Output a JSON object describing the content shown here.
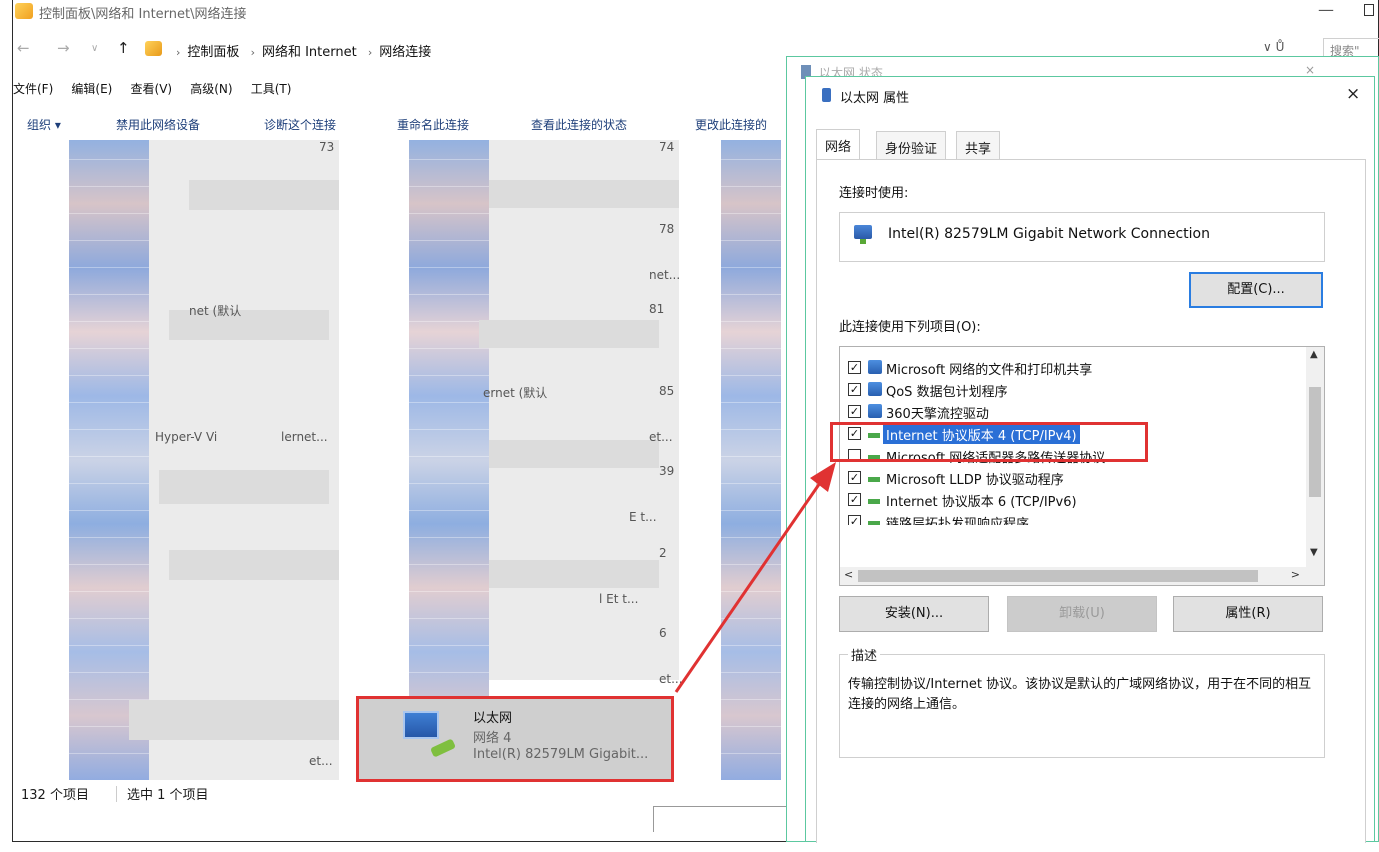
{
  "explorer": {
    "title": "控制面板\\网络和 Internet\\网络连接",
    "minimize": "—",
    "breadcrumbs": [
      "控制面板",
      "网络和 Internet",
      "网络连接"
    ],
    "search_placeholder": "搜索\"",
    "addr_controls": "∨ Ů",
    "menu": [
      "文件(F)",
      "编辑(E)",
      "查看(V)",
      "高级(N)",
      "工具(T)"
    ],
    "commands": [
      "组织 ▾",
      "禁用此网络设备",
      "诊断这个连接",
      "重命名此连接",
      "查看此连接的状态",
      "更改此连接的"
    ],
    "blurred_fragments": [
      "73",
      "74",
      "78",
      "net...",
      "81",
      "85",
      "Hyper-V Vi",
      "lernet...",
      "et...",
      "39",
      "E t...",
      "2",
      "l Et t...",
      "6",
      "et...",
      "et...",
      "net (默认",
      "ernet (默认"
    ],
    "selected_item": {
      "name": "以太网",
      "network": "网络 4",
      "adapter": "Intel(R) 82579LM Gigabit..."
    },
    "status": {
      "count": "132 个项目",
      "selected": "选中 1 个项目"
    }
  },
  "status_dialog": {
    "title": "以太网 状态",
    "close": "×"
  },
  "properties": {
    "title": "以太网 属性",
    "close": "×",
    "tabs": [
      "网络",
      "身份验证",
      "共享"
    ],
    "connect_using_label": "连接时使用:",
    "adapter_name": "Intel(R) 82579LM Gigabit Network Connection",
    "configure_button": "配置(C)...",
    "items_label": "此连接使用下列项目(O):",
    "items": [
      {
        "label": "Microsoft 网络的文件和打印机共享",
        "checked": true,
        "icon": "network-client-icon"
      },
      {
        "label": "QoS 数据包计划程序",
        "checked": true,
        "icon": "network-client-icon"
      },
      {
        "label": "360天擎流控驱动",
        "checked": true,
        "icon": "network-client-icon"
      },
      {
        "label": "Internet 协议版本 4 (TCP/IPv4)",
        "checked": true,
        "icon": "protocol-icon",
        "selected": true
      },
      {
        "label": "Microsoft 网络适配器多路传送器协议",
        "checked": false,
        "icon": "protocol-icon"
      },
      {
        "label": "Microsoft LLDP 协议驱动程序",
        "checked": true,
        "icon": "protocol-icon"
      },
      {
        "label": "Internet 协议版本 6 (TCP/IPv6)",
        "checked": true,
        "icon": "protocol-icon"
      },
      {
        "label": "链路层拓扑发现响应程序",
        "checked": true,
        "icon": "protocol-icon"
      }
    ],
    "install_button": "安装(N)...",
    "uninstall_button": "卸载(U)",
    "properties_button": "属性(R)",
    "description_label": "描述",
    "description_text": "传输控制协议/Internet 协议。该协议是默认的广域网络协议，用于在不同的相互连接的网络上通信。"
  },
  "colors": {
    "highlight_red": "#e03232",
    "selection_blue": "#2a6fd6",
    "dialog_border": "#5cc8a0"
  }
}
